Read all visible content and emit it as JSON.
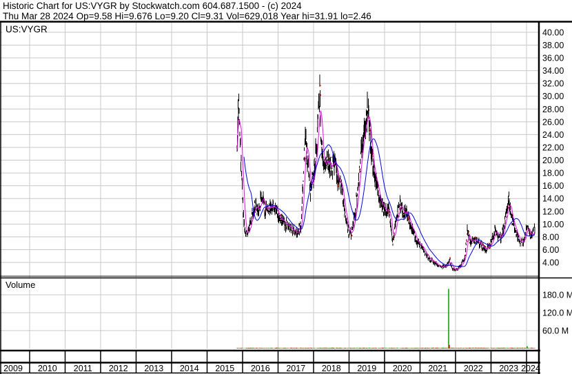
{
  "header": {
    "line1": "Historic Chart for US:VYGR by Stockwatch.com 604.687.1500 - (c) 2024",
    "line2": "Thu Mar 28 2024   Op=9.58   Hi=9.676   Lo=9.20   Cl=9.31   Vol=629,018   Year hi=31.91   lo=2.46"
  },
  "colors": {
    "bars": "#000000",
    "close_marks": "#ff0000",
    "ma_short": "#ff00ff",
    "ma_long": "#0000ff",
    "vol_up": "#00a000",
    "vol_down": "#ff0000",
    "grid": "#c8c8c8"
  },
  "chart_data": {
    "type": "line",
    "title": "US:VYGR",
    "price_axis": {
      "ticks": [
        "4.00",
        "6.00",
        "8.00",
        "10.00",
        "12.00",
        "14.00",
        "16.00",
        "18.00",
        "20.00",
        "22.00",
        "24.00",
        "26.00",
        "28.00",
        "30.00",
        "32.00",
        "34.00",
        "36.00",
        "38.00",
        "40.00"
      ],
      "ylim": [
        2,
        41
      ]
    },
    "volume_panel": {
      "label": "Volume",
      "ticks": [
        "60.0 M",
        "120.0 M",
        "180.0 M"
      ],
      "ylim": [
        0,
        230
      ]
    },
    "x_axis": {
      "ticks": [
        "2009",
        "2010",
        "2011",
        "2012",
        "2013",
        "2014",
        "2015",
        "2016",
        "2017",
        "2018",
        "2019",
        "2020",
        "2021",
        "2022",
        "2023",
        "2024"
      ],
      "xlim": [
        2009,
        2024.35
      ]
    },
    "grid": true,
    "series": [
      {
        "name": "price",
        "points": [
          [
            2015.83,
            18
          ],
          [
            2015.88,
            30
          ],
          [
            2015.94,
            22
          ],
          [
            2016.0,
            14
          ],
          [
            2016.06,
            9
          ],
          [
            2016.16,
            8.5
          ],
          [
            2016.25,
            11
          ],
          [
            2016.35,
            13
          ],
          [
            2016.45,
            12
          ],
          [
            2016.54,
            15
          ],
          [
            2016.64,
            12
          ],
          [
            2016.74,
            13
          ],
          [
            2016.83,
            12.5
          ],
          [
            2016.93,
            13
          ],
          [
            2017.03,
            11
          ],
          [
            2017.22,
            10
          ],
          [
            2017.42,
            9
          ],
          [
            2017.55,
            8.5
          ],
          [
            2017.65,
            10
          ],
          [
            2017.71,
            17
          ],
          [
            2017.77,
            24
          ],
          [
            2017.83,
            20
          ],
          [
            2017.9,
            15
          ],
          [
            2018.0,
            18
          ],
          [
            2018.08,
            22
          ],
          [
            2018.14,
            28
          ],
          [
            2018.17,
            31
          ],
          [
            2018.21,
            24
          ],
          [
            2018.29,
            19
          ],
          [
            2018.39,
            20
          ],
          [
            2018.49,
            19
          ],
          [
            2018.58,
            20
          ],
          [
            2018.68,
            17
          ],
          [
            2018.78,
            16
          ],
          [
            2018.87,
            12
          ],
          [
            2018.97,
            9
          ],
          [
            2019.07,
            8.5
          ],
          [
            2019.17,
            12
          ],
          [
            2019.26,
            16
          ],
          [
            2019.36,
            22
          ],
          [
            2019.46,
            25
          ],
          [
            2019.51,
            28
          ],
          [
            2019.59,
            24
          ],
          [
            2019.65,
            20
          ],
          [
            2019.75,
            17
          ],
          [
            2019.84,
            14
          ],
          [
            2019.94,
            13
          ],
          [
            2020.04,
            12
          ],
          [
            2020.14,
            12
          ],
          [
            2020.23,
            7
          ],
          [
            2020.33,
            11
          ],
          [
            2020.43,
            13
          ],
          [
            2020.52,
            12
          ],
          [
            2020.62,
            12
          ],
          [
            2020.72,
            10
          ],
          [
            2020.82,
            9
          ],
          [
            2020.91,
            7
          ],
          [
            2021.05,
            6.5
          ],
          [
            2021.2,
            5
          ],
          [
            2021.4,
            4
          ],
          [
            2021.59,
            3.2
          ],
          [
            2021.75,
            3.5
          ],
          [
            2021.83,
            4.5
          ],
          [
            2021.9,
            3
          ],
          [
            2022.02,
            2.8
          ],
          [
            2022.14,
            3.5
          ],
          [
            2022.27,
            5
          ],
          [
            2022.33,
            9
          ],
          [
            2022.41,
            7
          ],
          [
            2022.52,
            7.5
          ],
          [
            2022.66,
            7
          ],
          [
            2022.76,
            6.5
          ],
          [
            2022.87,
            6
          ],
          [
            2022.99,
            7
          ],
          [
            2023.11,
            9
          ],
          [
            2023.18,
            8
          ],
          [
            2023.3,
            8
          ],
          [
            2023.44,
            12
          ],
          [
            2023.5,
            14
          ],
          [
            2023.57,
            11
          ],
          [
            2023.69,
            9
          ],
          [
            2023.83,
            7
          ],
          [
            2023.92,
            7.5
          ],
          [
            2024.02,
            9.5
          ],
          [
            2024.12,
            8
          ],
          [
            2024.21,
            9
          ],
          [
            2024.24,
            9.31
          ]
        ]
      },
      {
        "name": "volume_spikes_M",
        "points": [
          [
            2021.81,
            200
          ],
          [
            2021.82,
            12
          ],
          [
            2024.02,
            8
          ]
        ]
      }
    ]
  }
}
